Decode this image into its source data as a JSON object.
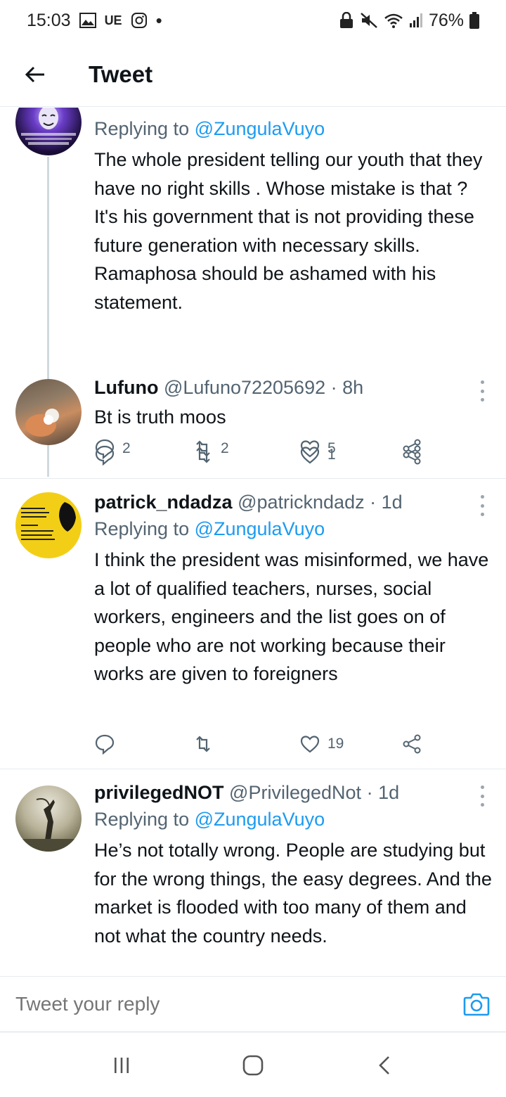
{
  "status_bar": {
    "time": "15:03",
    "carrier_badge": "UE",
    "battery": "76%"
  },
  "header": {
    "title": "Tweet"
  },
  "tweets": [
    {
      "author": {
        "name": "",
        "handle": "",
        "time": ""
      },
      "replying_prefix": "Replying to ",
      "replying_to": "@ZungulaVuyo",
      "text": "The whole president telling our youth that they have no right  skills . Whose mistake is that ? It's his government that is not providing these future generation with necessary skills. Ramaphosa should be ashamed with his statement.",
      "counts": {
        "replies": "2",
        "retweets": "2",
        "likes": "5"
      }
    },
    {
      "author": {
        "name": "Lufuno",
        "handle": "@Lufuno72205692",
        "time": "8h"
      },
      "text": "Bt is truth moos",
      "counts": {
        "replies": "",
        "retweets": "",
        "likes": "1"
      }
    },
    {
      "author": {
        "name": "patrick_ndadza",
        "handle": "@patrickndadz",
        "time": "1d"
      },
      "replying_prefix": "Replying to ",
      "replying_to": "@ZungulaVuyo",
      "text": "I think the president was misinformed, we have a lot of qualified teachers, nurses, social workers, engineers and the list goes on of people who are not working because their works are given to foreigners",
      "counts": {
        "replies": "",
        "retweets": "",
        "likes": "19"
      }
    },
    {
      "author": {
        "name": "privilegedNOT",
        "handle": "@PrivilegedNot",
        "time": "1d"
      },
      "replying_prefix": "Replying to ",
      "replying_to": "@ZungulaVuyo",
      "text": "He’s not totally wrong. People are studying but for the wrong things, the easy degrees. And the market is flooded with too many of them and not what the country needs."
    }
  ],
  "compose": {
    "placeholder": "Tweet your reply"
  },
  "colors": {
    "accent": "#1d9bf0",
    "secondary_text": "#536471",
    "primary_text": "#0f1419",
    "divider": "#e6ecf0"
  }
}
